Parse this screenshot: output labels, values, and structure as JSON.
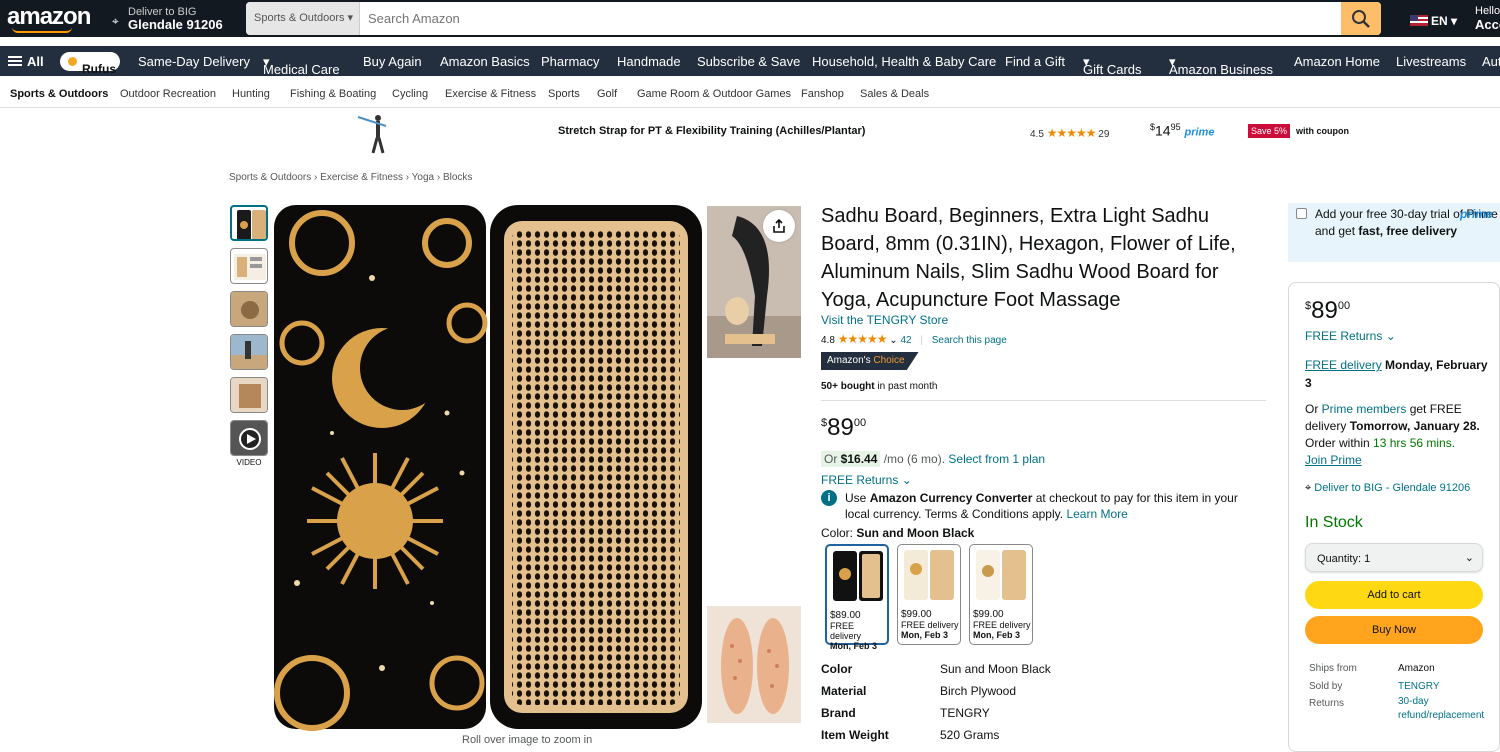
{
  "header": {
    "logo": "amazon",
    "deliver_line1": "Deliver to BIG",
    "deliver_line2": "Glendale 91206",
    "search_dept": "Sports & Outdoors",
    "search_placeholder": "Search Amazon",
    "lang": "EN",
    "account_line1": "Hello,",
    "account_line2": "Account"
  },
  "nav": {
    "all": "All",
    "rufus": "Rufus",
    "items": [
      "Same-Day Delivery",
      "Medical Care",
      "Buy Again",
      "Amazon Basics",
      "Pharmacy",
      "Handmade",
      "Subscribe & Save",
      "Household, Health & Baby Care",
      "Find a Gift",
      "Gift Cards",
      "Amazon Business",
      "Amazon Home",
      "Livestreams",
      "Aut"
    ]
  },
  "subnav": [
    "Sports & Outdoors",
    "Outdoor Recreation",
    "Hunting",
    "Fishing & Boating",
    "Cycling",
    "Exercise & Fitness",
    "Sports",
    "Golf",
    "Game Room & Outdoor Games",
    "Fanshop",
    "Sales & Deals"
  ],
  "banner": {
    "title": "Stretch Strap for PT & Flexibility Training (Achilles/Plantar)",
    "rating": "4.5",
    "stars": "★★★★★",
    "reviews": "29",
    "price_whole": "14",
    "price_cents": "95",
    "prime": "prime",
    "save": "Save 5%",
    "coupon": "with coupon"
  },
  "breadcrumb": "Sports & Outdoors  ›  Exercise & Fitness  ›  Yoga  ›  Blocks",
  "gallery": {
    "video_label": "VIDEO",
    "zoom_hint": "Roll over image to zoom in"
  },
  "product": {
    "title": "Sadhu Board, Beginners, Extra Light Sadhu Board, 8mm (0.31IN), Hexagon, Flower of Life, Aluminum Nails, Slim Sadhu Wood Board for Yoga, Acupuncture Foot Massage",
    "store": "Visit the TENGRY Store",
    "rating": "4.8",
    "stars": "★★★★★",
    "reviews": "42",
    "search_page": "Search this page",
    "choice_a": "Amazon's",
    "choice_b": "Choice",
    "bought_bold": "50+ bought",
    "bought_rest": " in past month",
    "price_whole": "89",
    "price_cents": "00",
    "installment_or": "Or ",
    "installment_amt": "$16.44",
    "installment_rest": " /mo (6 mo). ",
    "installment_link": "Select from 1 plan",
    "free_returns": "FREE Returns",
    "currency_a": "Use ",
    "currency_bold": "Amazon Currency Converter",
    "currency_b": " at checkout to pay for this item in your local currency. Terms & Conditions apply. ",
    "currency_link": "Learn More",
    "color_label": "Color: ",
    "color_value": "Sun and Moon Black",
    "swatches": [
      {
        "price": "$89.00",
        "delivery": "FREE delivery",
        "date": "Mon, Feb 3"
      },
      {
        "price": "$99.00",
        "delivery": "FREE delivery",
        "date": "Mon, Feb 3"
      },
      {
        "price": "$99.00",
        "delivery": "FREE delivery",
        "date": "Mon, Feb 3"
      }
    ],
    "specs": [
      {
        "key": "Color",
        "value": "Sun and Moon Black"
      },
      {
        "key": "Material",
        "value": "Birch Plywood"
      },
      {
        "key": "Brand",
        "value": "TENGRY"
      },
      {
        "key": "Item Weight",
        "value": "520 Grams"
      }
    ]
  },
  "prime_trial": {
    "text_a": "Add your free 30-day trial of Prime and get ",
    "text_bold": "fast, free delivery",
    "logo": "prime"
  },
  "buybox": {
    "price_whole": "89",
    "price_cents": "00",
    "free_returns": "FREE Returns",
    "free_delivery": "FREE delivery",
    "delivery_date": "Monday, February 3",
    "prime_or": "Or ",
    "prime_members": "Prime members",
    "prime_get": " get FREE delivery ",
    "prime_date": "Tomorrow, January 28.",
    "order_within": " Order within ",
    "countdown": "13 hrs 56 mins.",
    "join_prime": "Join Prime",
    "deliver_to": "Deliver to BIG - Glendale 91206",
    "stock": "In Stock",
    "quantity": "Quantity:  1",
    "add_to_cart": "Add to cart",
    "buy_now": "Buy Now",
    "ships_from_label": "Ships from",
    "ships_from": "Amazon",
    "sold_by_label": "Sold by",
    "sold_by": "TENGRY",
    "returns_label": "Returns",
    "returns": "30-day refund/replacement"
  },
  "colors": {
    "header_bg": "#131921",
    "nav_bg": "#232F3E",
    "accent": "#FF9900",
    "link": "#007185",
    "cart": "#FFD814",
    "buy": "#FFA41C"
  }
}
